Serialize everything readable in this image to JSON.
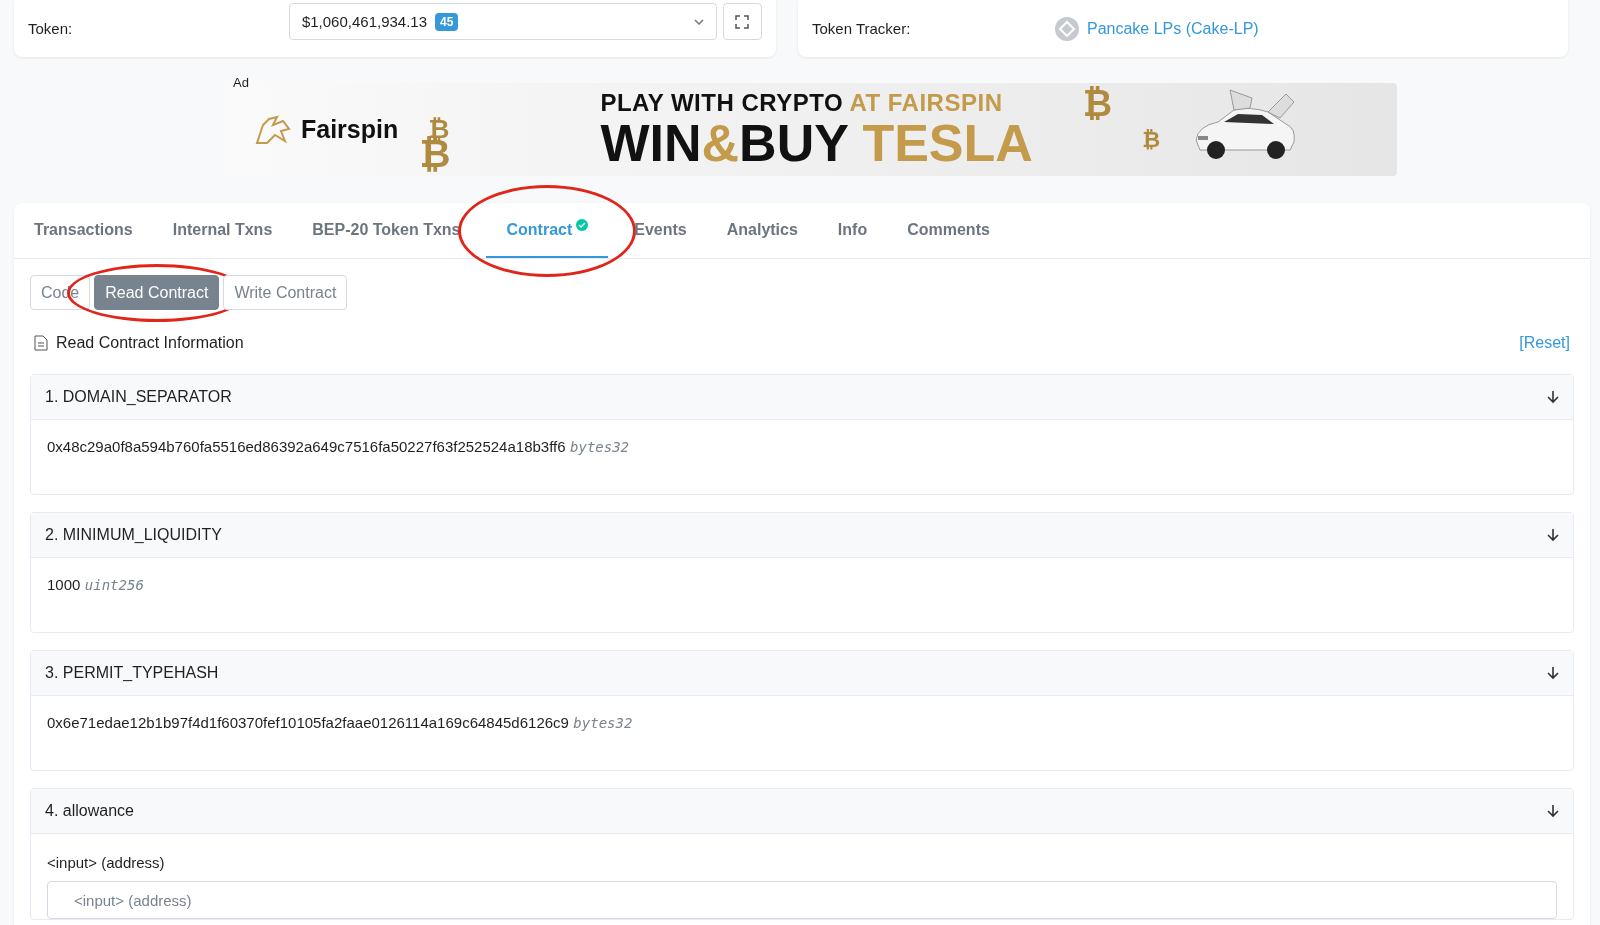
{
  "token_card": {
    "label": "Token:",
    "value": "$1,060,461,934.13",
    "badge": "45"
  },
  "tracker_card": {
    "label": "Token Tracker:",
    "link": "Pancake LPs (Cake-LP)"
  },
  "ad": {
    "label": "Ad",
    "brand": "Fairspin",
    "line_1": "PLAY WITH CRYPTO",
    "line_1_accent": "AT FAIRSPIN",
    "line_2_a": "WIN",
    "line_2_amp": "&",
    "line_2_b": "BUY",
    "line_2_accent": "TESLA",
    "coin": "₿"
  },
  "tabs": [
    {
      "label": "Transactions",
      "selected": false,
      "verified": false,
      "circled": false
    },
    {
      "label": "Internal Txns",
      "selected": false,
      "verified": false,
      "circled": false
    },
    {
      "label": "BEP-20 Token Txns",
      "selected": false,
      "verified": false,
      "circled": false
    },
    {
      "label": "Contract",
      "selected": true,
      "verified": true,
      "circled": true
    },
    {
      "label": "Events",
      "selected": false,
      "verified": false,
      "circled": false
    },
    {
      "label": "Analytics",
      "selected": false,
      "verified": false,
      "circled": false
    },
    {
      "label": "Info",
      "selected": false,
      "verified": false,
      "circled": false
    },
    {
      "label": "Comments",
      "selected": false,
      "verified": false,
      "circled": false
    }
  ],
  "sub_tabs": [
    {
      "label": "Code",
      "selected": false,
      "circled": false
    },
    {
      "label": "Read Contract",
      "selected": true,
      "circled": true
    },
    {
      "label": "Write Contract",
      "selected": false,
      "circled": false
    }
  ],
  "section_title": "Read Contract Information",
  "reset": "[Reset]",
  "functions": [
    {
      "kind": "value",
      "title": "1. DOMAIN_SEPARATOR",
      "value": "0x48c29a0f8a594b760fa5516ed86392a649c7516fa50227f63f252524a18b3ff6",
      "type": "bytes32"
    },
    {
      "kind": "value",
      "title": "2. MINIMUM_LIQUIDITY",
      "value": "1000",
      "type": "uint256"
    },
    {
      "kind": "value",
      "title": "3. PERMIT_TYPEHASH",
      "value": "0x6e71edae12b1b97f4d1f60370fef10105fa2faae0126114a169c64845d6126c9",
      "type": "bytes32"
    },
    {
      "kind": "input",
      "title": "4. allowance",
      "input_label": "<input> (address)",
      "placeholder": "<input> (address)"
    }
  ]
}
